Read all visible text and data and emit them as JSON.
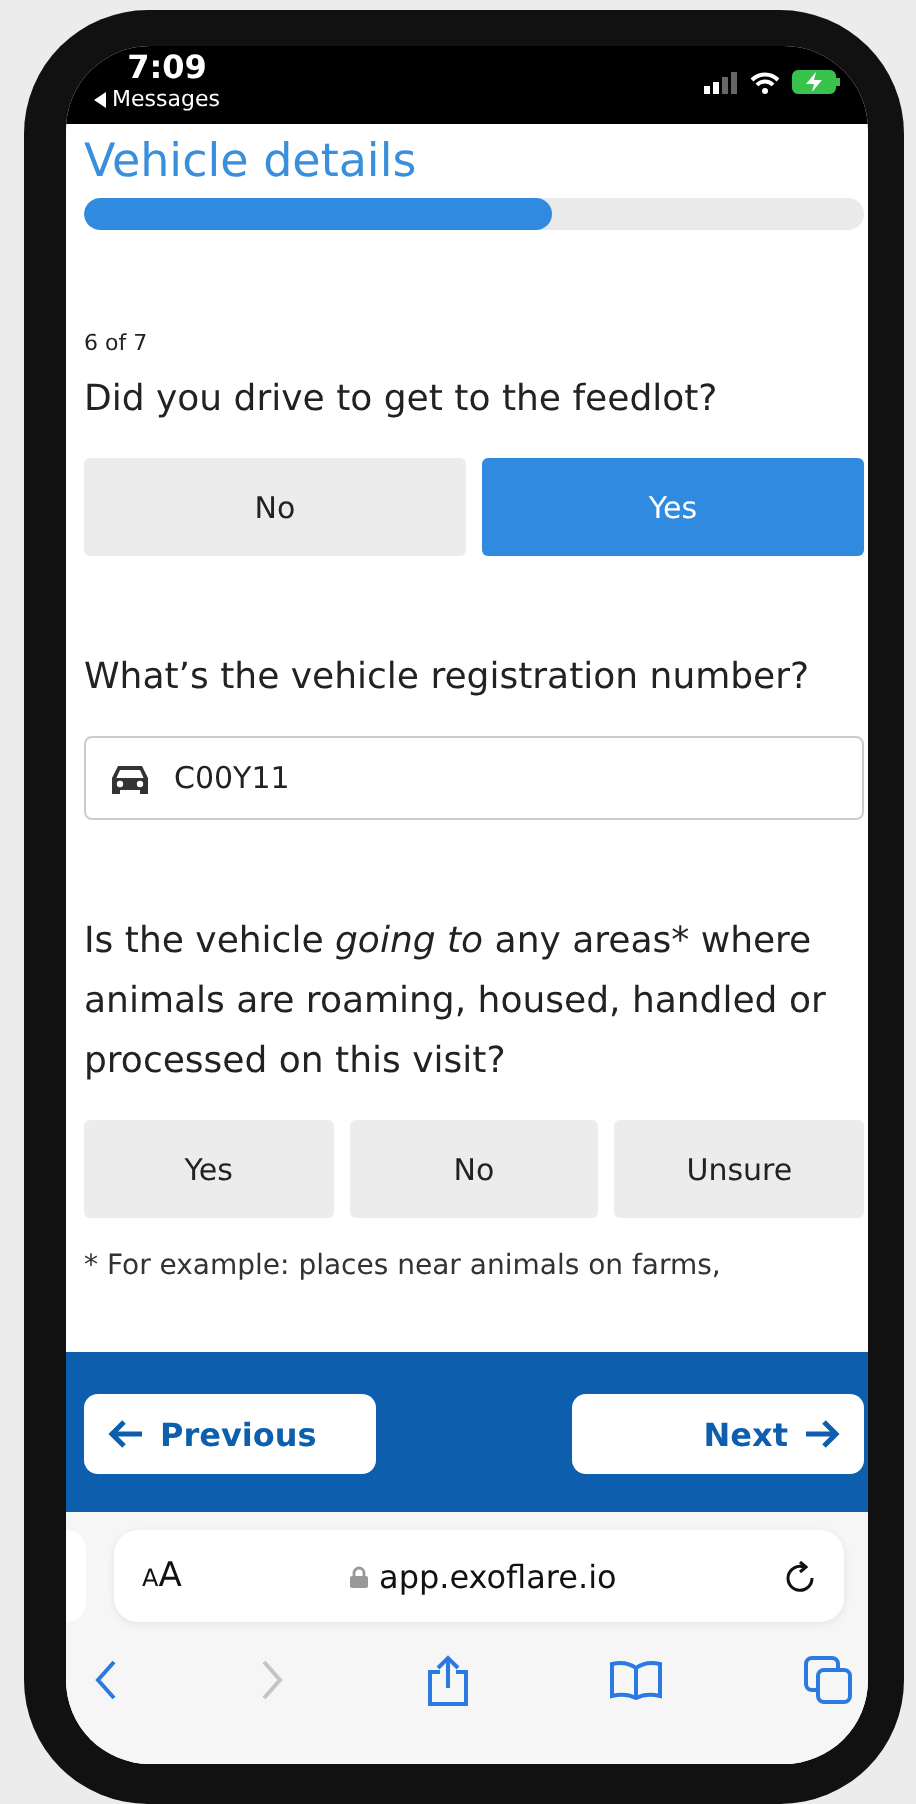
{
  "status_bar": {
    "time": "7:09",
    "back_app": "Messages"
  },
  "page": {
    "title": "Vehicle details",
    "progress": {
      "level": 0.6
    },
    "step": "6 of 7",
    "questions": [
      {
        "kind": "choice",
        "text": "Did you drive to get to the feedlot?",
        "options": [
          {
            "label": "No",
            "selected": false
          },
          {
            "label": "Yes",
            "selected": true
          }
        ]
      },
      {
        "kind": "text",
        "text": "What’s the vehicle registration number?",
        "value": "C00Y11"
      },
      {
        "kind": "choice",
        "text": "Is the vehicle *going to* any areas* where animals are roaming, housed, handled or processed on this visit?",
        "options": [
          {
            "label": "Yes",
            "selected": false
          },
          {
            "label": "No",
            "selected": false
          },
          {
            "label": "Unsure",
            "selected": false
          }
        ]
      }
    ],
    "footnote": "* For example: places near animals on farms,"
  },
  "footer": {
    "previous": "Previous",
    "next": "Next"
  },
  "browser": {
    "text_size": "AA",
    "url": "app.exoflare.io",
    "forward_disabled": true
  }
}
